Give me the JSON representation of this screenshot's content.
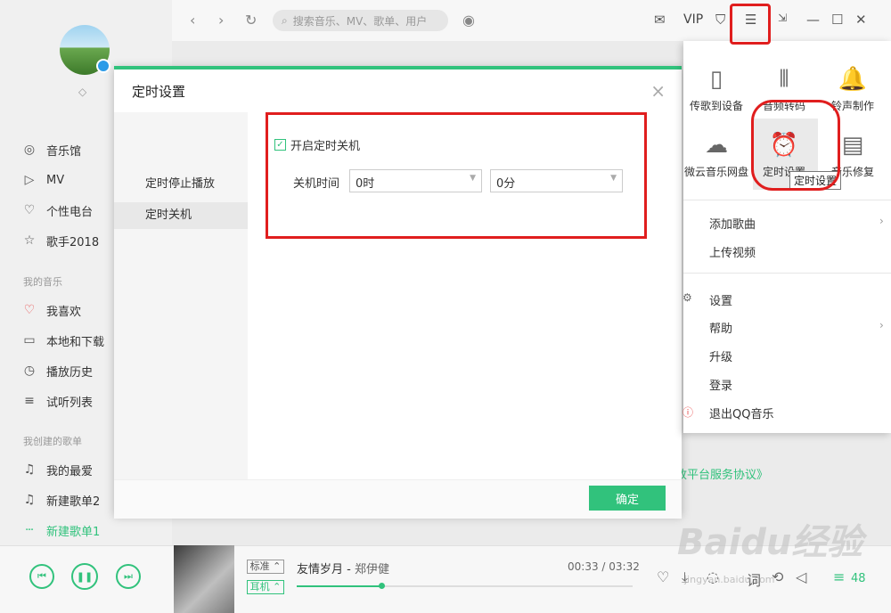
{
  "sidebar": {
    "items": [
      {
        "label": "音乐馆",
        "icon": "music-hall-icon"
      },
      {
        "label": "MV",
        "icon": "mv-icon"
      },
      {
        "label": "个性电台",
        "icon": "radio-icon"
      },
      {
        "label": "歌手2018",
        "icon": "star-icon"
      }
    ],
    "my_music_heading": "我的音乐",
    "my_music": [
      {
        "label": "我喜欢",
        "icon": "heart-icon"
      },
      {
        "label": "本地和下载",
        "icon": "monitor-icon"
      },
      {
        "label": "播放历史",
        "icon": "clock-icon"
      },
      {
        "label": "试听列表",
        "icon": "list-icon"
      }
    ],
    "created_heading": "我创建的歌单",
    "created": [
      {
        "label": "我的最爱",
        "icon": "note-icon"
      },
      {
        "label": "新建歌单2",
        "icon": "note-icon"
      },
      {
        "label": "新建歌单1",
        "icon": "playing-bars-icon"
      }
    ]
  },
  "topbar": {
    "search_placeholder": "搜索音乐、MV、歌单、用户",
    "vip": "VIP"
  },
  "dialog": {
    "title": "定时设置",
    "tabs": [
      "定时停止播放",
      "定时关机"
    ],
    "active_tab": "定时关机",
    "enable_label": "开启定时关机",
    "time_label": "关机时间",
    "hour_value": "0时",
    "minute_value": "0分",
    "confirm": "确定"
  },
  "menu": {
    "tools": [
      {
        "label": "传歌到设备",
        "icon": "phone-icon"
      },
      {
        "label": "音频转码",
        "icon": "waveform-icon"
      },
      {
        "label": "铃声制作",
        "icon": "bell-icon"
      },
      {
        "label": "微云音乐网盘",
        "icon": "cloud-icon"
      },
      {
        "label": "定时设置",
        "icon": "alarm-clock-icon"
      },
      {
        "label": "音乐修复",
        "icon": "repair-icon"
      }
    ],
    "tooltip": "定时设置",
    "items": [
      {
        "label": "添加歌曲"
      },
      {
        "label": "上传视频"
      },
      {
        "label": "设置"
      },
      {
        "label": "帮助"
      },
      {
        "label": "升级"
      },
      {
        "label": "登录"
      },
      {
        "label": "退出QQ音乐"
      }
    ]
  },
  "background": {
    "agreement_link": "放平台服务协议》"
  },
  "player": {
    "quality_tag": "标准",
    "output_tag": "耳机",
    "song": "友情岁月",
    "artist": "郑伊健",
    "separator": " - ",
    "time": "00:33 / 03:32",
    "progress": 0.251,
    "playlist_count": "48"
  },
  "watermark": {
    "text": "Baidu经验",
    "url": "jingyan.baidu.com"
  },
  "colors": {
    "accent": "#31c27c",
    "highlight": "#e01e1e"
  }
}
